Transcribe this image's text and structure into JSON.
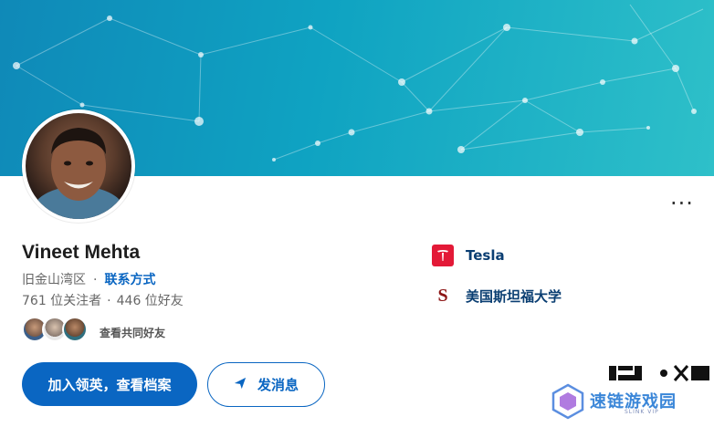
{
  "profile": {
    "name": "Vineet Mehta",
    "location": "旧金山湾区",
    "contact_link": "联系方式",
    "followers": "761 位关注者",
    "connections": "446 位好友",
    "mutual_link": "查看共同好友"
  },
  "actions": {
    "join_label": "加入领英，查看档案",
    "message_label": "发消息",
    "more_label": "..."
  },
  "organizations": [
    {
      "name": "Tesla",
      "logo_color": "#e31937",
      "icon": "tesla-logo-icon"
    },
    {
      "name": "美国斯坦福大学",
      "logo_color": "#8c1515",
      "icon": "stanford-logo-icon"
    }
  ],
  "watermark": {
    "text": "速链游戏园",
    "subtext": "SLINK VIP"
  },
  "colors": {
    "accent": "#0a66c2",
    "banner_start": "#0f89b8",
    "banner_end": "#2ec0c9"
  }
}
